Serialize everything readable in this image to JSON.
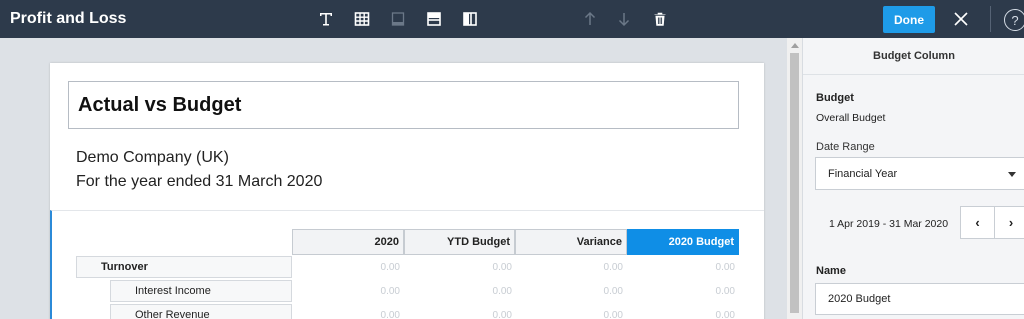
{
  "header": {
    "title": "Profit and Loss",
    "toolbar_icons": [
      "text-icon",
      "table-icon",
      "footer-icon",
      "split-horizontal-icon",
      "split-vertical-icon",
      "arrow-up-icon",
      "arrow-down-icon",
      "trash-icon"
    ],
    "done_label": "Done",
    "help_label": "?"
  },
  "report": {
    "title": "Actual vs Budget",
    "company": "Demo Company (UK)",
    "period": "For the year ended 31 March 2020",
    "columns": [
      "2020",
      "YTD Budget",
      "Variance",
      "2020 Budget"
    ],
    "active_column": "2020 Budget",
    "rows": [
      {
        "label": "Turnover",
        "values": [
          "0.00",
          "0.00",
          "0.00",
          "0.00"
        ]
      },
      {
        "label": "Interest Income",
        "values": [
          "0.00",
          "0.00",
          "0.00",
          "0.00"
        ]
      },
      {
        "label": "Other Revenue",
        "values": [
          "0.00",
          "0.00",
          "0.00",
          "0.00"
        ]
      }
    ]
  },
  "panel": {
    "title": "Budget Column",
    "budget_label": "Budget",
    "budget_value": "Overall Budget",
    "date_range_label": "Date Range",
    "date_range_value": "Financial Year",
    "range_text": "1 Apr 2019 - 31 Mar 2020",
    "prev_label": "‹",
    "next_label": "›",
    "name_label": "Name",
    "name_value": "2020  Budget"
  },
  "colors": {
    "header_bg": "#2d3a4b",
    "accent": "#1e9be8",
    "active_column": "#0f8ee6",
    "canvas_bg": "#dde1e6"
  }
}
